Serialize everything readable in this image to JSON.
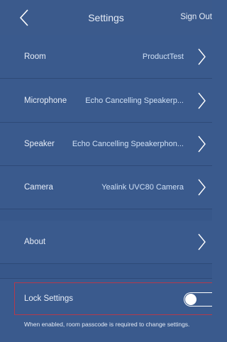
{
  "header": {
    "title": "Settings",
    "sign_out_label": "Sign Out"
  },
  "rows": [
    {
      "label": "Room",
      "value": "ProductTest"
    },
    {
      "label": "Microphone",
      "value": "Echo Cancelling Speakerp..."
    },
    {
      "label": "Speaker",
      "value": "Echo Cancelling Speakerphon..."
    },
    {
      "label": "Camera",
      "value": "Yealink UVC80 Camera"
    },
    {
      "label": "About",
      "value": ""
    }
  ],
  "lock": {
    "label": "Lock Settings",
    "enabled": false,
    "hint": "When enabled, room passcode is required to change settings."
  },
  "colors": {
    "background": "#3a5a8d",
    "highlight_border": "#b43a4c"
  },
  "icons": {
    "back": "chevron-left-icon",
    "row_arrow": "chevron-right-icon"
  }
}
